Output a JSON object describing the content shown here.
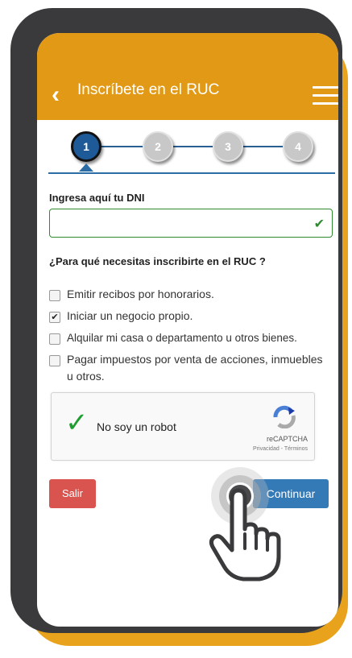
{
  "header": {
    "title": "Inscríbete en el RUC",
    "back_icon": "chevron-left-icon",
    "menu_icon": "hamburger-menu-icon"
  },
  "steps": [
    {
      "number": "1",
      "state": "active"
    },
    {
      "number": "2",
      "state": "inactive"
    },
    {
      "number": "3",
      "state": "inactive"
    },
    {
      "number": "4",
      "state": "inactive"
    }
  ],
  "form": {
    "dni_label": "Ingresa aquí tu DNI",
    "dni_value": "",
    "dni_status_icon": "check-icon",
    "question": "¿Para qué necesitas inscribirte en el RUC ?",
    "options": [
      {
        "label": "Emitir recibos por honorarios.",
        "checked": false
      },
      {
        "label": "Iniciar un negocio propio.",
        "checked": true
      },
      {
        "label": "Alquilar mi casa o departamento u otros bienes.",
        "checked": false
      },
      {
        "label": "Pagar impuestos por venta de acciones, inmuebles u otros.",
        "checked": false
      }
    ]
  },
  "captcha": {
    "label": "No soy un robot",
    "brand": "reCAPTCHA",
    "links": "Privacidad - Términos",
    "checked": true
  },
  "buttons": {
    "exit_label": "Salir",
    "continue_label": "Continuar"
  },
  "colors": {
    "accent_orange": "#e29a16",
    "primary_blue": "#337ab7",
    "danger_red": "#d9534f",
    "success_green": "#2f8a2f",
    "frame_dark": "#3a3a3c"
  }
}
